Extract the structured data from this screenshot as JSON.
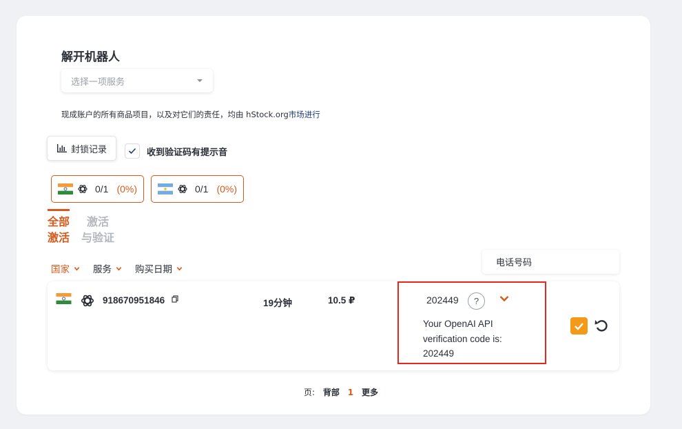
{
  "page": {
    "title": "解开机器人",
    "service_select": {
      "placeholder": "选择一项服务"
    },
    "note": {
      "prefix": "现成账户的所有商品项目，以及对它们的责任，均由 hStock.org",
      "link": "市场进行"
    },
    "history_button": "封锁记录",
    "sound_toggle": {
      "label": "收到验证码有提示音",
      "checked": true
    },
    "stats": [
      {
        "flag": "india-flag",
        "service_icon": "openai-icon",
        "count": "0/1",
        "percent": "(0%)"
      },
      {
        "flag": "argentina-flag",
        "service_icon": "openai-icon",
        "count": "0/1",
        "percent": "(0%)"
      }
    ],
    "tabs": [
      {
        "line1": "全部",
        "line2": "激活",
        "active": true
      },
      {
        "line1": "激活",
        "line2": "与验证",
        "active": false
      }
    ],
    "filters": [
      {
        "label": "国家",
        "active": true
      },
      {
        "label": "服务",
        "active": false
      },
      {
        "label": "购买日期",
        "active": false
      }
    ],
    "phone_header": "电话号码",
    "rows": [
      {
        "flag": "india-flag",
        "service_icon": "openai-icon",
        "phone": "918670951846",
        "duration": "19分钟",
        "price": "10.5 ₽",
        "code": "202449",
        "sms": "Your OpenAI API verification code is: 202449"
      }
    ],
    "pagination": {
      "label": "页:",
      "back": "背部",
      "current": "1",
      "more": "更多"
    },
    "colors": {
      "accent": "#d75a1c",
      "highlight_box": "#e8261b",
      "confirm": "#f39a1a"
    }
  }
}
